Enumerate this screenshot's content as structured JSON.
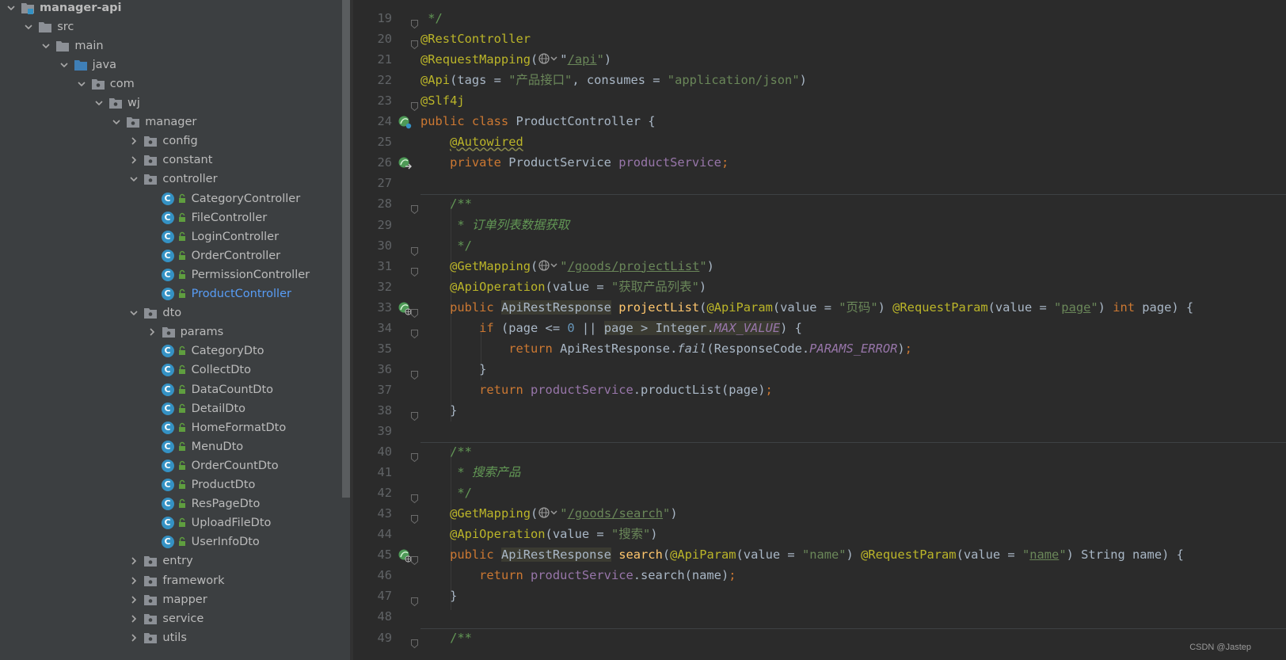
{
  "tree": {
    "rows": [
      {
        "label": "manager-api",
        "depth": 0,
        "chev": "down",
        "icon": "module",
        "root": true
      },
      {
        "label": "src",
        "depth": 1,
        "chev": "down",
        "icon": "folder"
      },
      {
        "label": "main",
        "depth": 2,
        "chev": "down",
        "icon": "folder"
      },
      {
        "label": "java",
        "depth": 3,
        "chev": "down",
        "icon": "source-folder"
      },
      {
        "label": "com",
        "depth": 4,
        "chev": "down",
        "icon": "package"
      },
      {
        "label": "wj",
        "depth": 5,
        "chev": "down",
        "icon": "package"
      },
      {
        "label": "manager",
        "depth": 6,
        "chev": "down",
        "icon": "package"
      },
      {
        "label": "config",
        "depth": 7,
        "chev": "right",
        "icon": "package"
      },
      {
        "label": "constant",
        "depth": 7,
        "chev": "right",
        "icon": "package"
      },
      {
        "label": "controller",
        "depth": 7,
        "chev": "down",
        "icon": "package"
      },
      {
        "label": "CategoryController",
        "depth": 8,
        "chev": "none",
        "icon": "class"
      },
      {
        "label": "FileController",
        "depth": 8,
        "chev": "none",
        "icon": "class"
      },
      {
        "label": "LoginController",
        "depth": 8,
        "chev": "none",
        "icon": "class"
      },
      {
        "label": "OrderController",
        "depth": 8,
        "chev": "none",
        "icon": "class"
      },
      {
        "label": "PermissionController",
        "depth": 8,
        "chev": "none",
        "icon": "class"
      },
      {
        "label": "ProductController",
        "depth": 8,
        "chev": "none",
        "icon": "class",
        "selected": true
      },
      {
        "label": "dto",
        "depth": 7,
        "chev": "down",
        "icon": "package"
      },
      {
        "label": "params",
        "depth": 8,
        "chev": "right",
        "icon": "package"
      },
      {
        "label": "CategoryDto",
        "depth": 8,
        "chev": "none",
        "icon": "class"
      },
      {
        "label": "CollectDto",
        "depth": 8,
        "chev": "none",
        "icon": "class"
      },
      {
        "label": "DataCountDto",
        "depth": 8,
        "chev": "none",
        "icon": "class"
      },
      {
        "label": "DetailDto",
        "depth": 8,
        "chev": "none",
        "icon": "class"
      },
      {
        "label": "HomeFormatDto",
        "depth": 8,
        "chev": "none",
        "icon": "class"
      },
      {
        "label": "MenuDto",
        "depth": 8,
        "chev": "none",
        "icon": "class"
      },
      {
        "label": "OrderCountDto",
        "depth": 8,
        "chev": "none",
        "icon": "class"
      },
      {
        "label": "ProductDto",
        "depth": 8,
        "chev": "none",
        "icon": "class"
      },
      {
        "label": "ResPageDto",
        "depth": 8,
        "chev": "none",
        "icon": "class"
      },
      {
        "label": "UploadFileDto",
        "depth": 8,
        "chev": "none",
        "icon": "class"
      },
      {
        "label": "UserInfoDto",
        "depth": 8,
        "chev": "none",
        "icon": "class"
      },
      {
        "label": "entry",
        "depth": 7,
        "chev": "right",
        "icon": "package"
      },
      {
        "label": "framework",
        "depth": 7,
        "chev": "right",
        "icon": "package"
      },
      {
        "label": "mapper",
        "depth": 7,
        "chev": "right",
        "icon": "package"
      },
      {
        "label": "service",
        "depth": 7,
        "chev": "right",
        "icon": "package"
      },
      {
        "label": "utils",
        "depth": 7,
        "chev": "right",
        "icon": "package"
      }
    ]
  },
  "editor": {
    "lines": [
      {
        "n": "19",
        "fold": true,
        "segs": [
          [
            " */",
            "cm"
          ]
        ]
      },
      {
        "n": "20",
        "fold": true,
        "segs": [
          [
            "@RestController",
            "an"
          ]
        ]
      },
      {
        "n": "21",
        "segs": [
          [
            "@RequestMapping",
            "an"
          ],
          [
            "(",
            ""
          ],
          [
            "@globe",
            ""
          ],
          [
            "\"",
            ""
          ],
          [
            "/api",
            "su"
          ],
          [
            "\"",
            "s"
          ],
          [
            ")",
            ""
          ]
        ]
      },
      {
        "n": "22",
        "segs": [
          [
            "@Api",
            "an"
          ],
          [
            "(tags = ",
            ""
          ],
          [
            "\"产品接口\"",
            "s"
          ],
          [
            ", consumes = ",
            ""
          ],
          [
            "\"application/json\"",
            "s"
          ],
          [
            ")",
            ""
          ]
        ]
      },
      {
        "n": "23",
        "fold": true,
        "segs": [
          [
            "@Slf4j",
            "an"
          ]
        ]
      },
      {
        "n": "24",
        "icon": "bean",
        "segs": [
          [
            "public class ",
            "k"
          ],
          [
            "ProductController {",
            ""
          ]
        ]
      },
      {
        "n": "25",
        "segs": [
          [
            "    ",
            ""
          ],
          [
            "@Autowired",
            "an wv"
          ]
        ]
      },
      {
        "n": "26",
        "icon": "bean-arrow",
        "segs": [
          [
            "    ",
            ""
          ],
          [
            "private ",
            "k"
          ],
          [
            "ProductService ",
            ""
          ],
          [
            "productService",
            "fd"
          ],
          [
            ";",
            "k"
          ]
        ]
      },
      {
        "n": "27",
        "sepAfter": true,
        "segs": []
      },
      {
        "n": "28",
        "fold": true,
        "segs": [
          [
            "    /**",
            "cm"
          ]
        ]
      },
      {
        "n": "29",
        "segs": [
          [
            "     * ",
            "cm"
          ],
          [
            "订单列表数据获取",
            "ci"
          ]
        ]
      },
      {
        "n": "30",
        "fold": true,
        "segs": [
          [
            "     */",
            "cm"
          ]
        ]
      },
      {
        "n": "31",
        "fold": true,
        "segs": [
          [
            "    ",
            ""
          ],
          [
            "@GetMapping",
            "an"
          ],
          [
            "(",
            ""
          ],
          [
            "@globe",
            ""
          ],
          [
            "\"",
            "s"
          ],
          [
            "/goods/projectList",
            "su"
          ],
          [
            "\"",
            "s"
          ],
          [
            ")",
            ""
          ]
        ]
      },
      {
        "n": "32",
        "segs": [
          [
            "    ",
            ""
          ],
          [
            "@ApiOperation",
            "an"
          ],
          [
            "(value = ",
            ""
          ],
          [
            "\"获取产品列表\"",
            "s"
          ],
          [
            ")",
            ""
          ]
        ]
      },
      {
        "n": "33",
        "icon": "web",
        "fold": true,
        "segs": [
          [
            "    ",
            ""
          ],
          [
            "public ",
            "k"
          ],
          [
            "ApiRestResponse",
            "hl"
          ],
          [
            " ",
            ""
          ],
          [
            "projectList",
            "fn"
          ],
          [
            "(",
            ""
          ],
          [
            "@ApiParam",
            "an"
          ],
          [
            "(value = ",
            ""
          ],
          [
            "\"页码\"",
            "s"
          ],
          [
            ") ",
            ""
          ],
          [
            "@RequestParam",
            "an"
          ],
          [
            "(value = ",
            ""
          ],
          [
            "\"",
            "s"
          ],
          [
            "page",
            "su"
          ],
          [
            "\"",
            "s"
          ],
          [
            ") ",
            ""
          ],
          [
            "int ",
            "k"
          ],
          [
            "page) {",
            ""
          ]
        ]
      },
      {
        "n": "34",
        "fold": true,
        "segs": [
          [
            "        ",
            ""
          ],
          [
            "if ",
            "k"
          ],
          [
            "(page <= ",
            ""
          ],
          [
            "0",
            "nm"
          ],
          [
            " || ",
            ""
          ],
          [
            "page > Integer.",
            "hl"
          ],
          [
            "MAX_VALUE",
            "fdi hl"
          ],
          [
            ") {",
            ""
          ]
        ]
      },
      {
        "n": "35",
        "segs": [
          [
            "            ",
            ""
          ],
          [
            "return ",
            "k"
          ],
          [
            "ApiRestResponse.",
            ""
          ],
          [
            "fail",
            "it"
          ],
          [
            "(ResponseCode.",
            ""
          ],
          [
            "PARAMS_ERROR",
            "fdi"
          ],
          [
            ")",
            ""
          ],
          [
            ";",
            "k"
          ]
        ]
      },
      {
        "n": "36",
        "fold": true,
        "segs": [
          [
            "        }",
            ""
          ]
        ]
      },
      {
        "n": "37",
        "segs": [
          [
            "        ",
            ""
          ],
          [
            "return ",
            "k"
          ],
          [
            "productService",
            "fd"
          ],
          [
            ".productList(page)",
            ""
          ],
          [
            ";",
            "k"
          ]
        ]
      },
      {
        "n": "38",
        "fold": true,
        "segs": [
          [
            "    }",
            ""
          ]
        ]
      },
      {
        "n": "39",
        "sepAfter": true,
        "segs": []
      },
      {
        "n": "40",
        "fold": true,
        "segs": [
          [
            "    /**",
            "cm"
          ]
        ]
      },
      {
        "n": "41",
        "segs": [
          [
            "     * ",
            "cm"
          ],
          [
            "搜索产品",
            "ci"
          ]
        ]
      },
      {
        "n": "42",
        "fold": true,
        "segs": [
          [
            "     */",
            "cm"
          ]
        ]
      },
      {
        "n": "43",
        "fold": true,
        "segs": [
          [
            "    ",
            ""
          ],
          [
            "@GetMapping",
            "an"
          ],
          [
            "(",
            ""
          ],
          [
            "@globe",
            ""
          ],
          [
            "\"",
            "s"
          ],
          [
            "/goods/search",
            "su"
          ],
          [
            "\"",
            "s"
          ],
          [
            ")",
            ""
          ]
        ]
      },
      {
        "n": "44",
        "segs": [
          [
            "    ",
            ""
          ],
          [
            "@ApiOperation",
            "an"
          ],
          [
            "(value = ",
            ""
          ],
          [
            "\"搜索\"",
            "s"
          ],
          [
            ")",
            ""
          ]
        ]
      },
      {
        "n": "45",
        "icon": "web",
        "fold": true,
        "segs": [
          [
            "    ",
            ""
          ],
          [
            "public ",
            "k"
          ],
          [
            "ApiRestResponse",
            "hl"
          ],
          [
            " ",
            ""
          ],
          [
            "search",
            "fn"
          ],
          [
            "(",
            ""
          ],
          [
            "@ApiParam",
            "an"
          ],
          [
            "(value = ",
            ""
          ],
          [
            "\"name\"",
            "s"
          ],
          [
            ") ",
            ""
          ],
          [
            "@RequestParam",
            "an"
          ],
          [
            "(value = ",
            ""
          ],
          [
            "\"",
            "s"
          ],
          [
            "name",
            "su"
          ],
          [
            "\"",
            "s"
          ],
          [
            ") ",
            ""
          ],
          [
            "String name) {",
            ""
          ]
        ]
      },
      {
        "n": "46",
        "segs": [
          [
            "        ",
            ""
          ],
          [
            "return ",
            "k"
          ],
          [
            "productService",
            "fd"
          ],
          [
            ".search(name)",
            ""
          ],
          [
            ";",
            "k"
          ]
        ]
      },
      {
        "n": "47",
        "fold": true,
        "segs": [
          [
            "    }",
            ""
          ]
        ]
      },
      {
        "n": "48",
        "sepAfter": true,
        "segs": []
      },
      {
        "n": "49",
        "fold": true,
        "segs": [
          [
            "    /**",
            "cm"
          ]
        ]
      }
    ]
  },
  "watermark": "CSDN @Jastep"
}
